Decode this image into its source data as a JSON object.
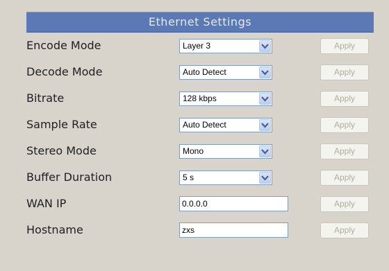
{
  "panel": {
    "title": "Ethernet Settings"
  },
  "rows": [
    {
      "label": "Encode Mode",
      "type": "select",
      "value": "Layer 3",
      "apply": "Apply"
    },
    {
      "label": "Decode Mode",
      "type": "select",
      "value": "Auto Detect",
      "apply": "Apply"
    },
    {
      "label": "Bitrate",
      "type": "select",
      "value": "128 kbps",
      "apply": "Apply"
    },
    {
      "label": "Sample Rate",
      "type": "select",
      "value": "Auto Detect",
      "apply": "Apply"
    },
    {
      "label": "Stereo Mode",
      "type": "select",
      "value": "Mono",
      "apply": "Apply"
    },
    {
      "label": "Buffer Duration",
      "type": "select",
      "value": "5 s",
      "apply": "Apply"
    },
    {
      "label": "WAN IP",
      "type": "text",
      "value": "0.0.0.0",
      "apply": "Apply"
    },
    {
      "label": "Hostname",
      "type": "text",
      "value": "zxs",
      "apply": "Apply"
    }
  ],
  "icons": {
    "dropdown": "chevron-down-icon"
  },
  "colors": {
    "header_bg": "#5b79b4",
    "header_text": "#e3ebf7",
    "page_bg": "#d8d4cc",
    "disabled_text": "#b0ad9e"
  }
}
